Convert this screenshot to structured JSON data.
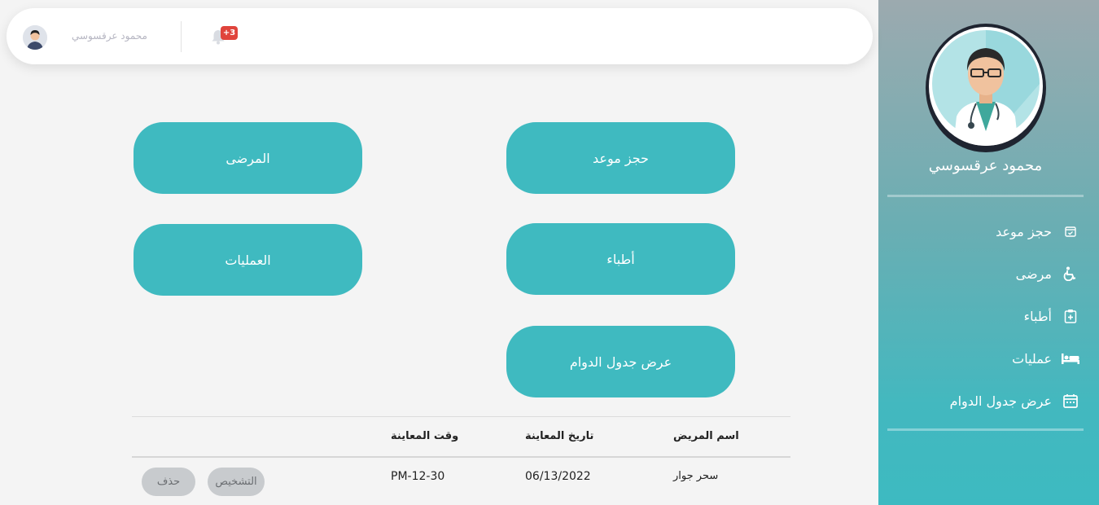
{
  "profile": {
    "name": "محمود عرقسوسي"
  },
  "menu": [
    {
      "label": "حجز موعد",
      "icon": "calendar-check-icon"
    },
    {
      "label": "مرضى",
      "icon": "wheelchair-icon"
    },
    {
      "label": "أطباء",
      "icon": "clipboard-plus-icon"
    },
    {
      "label": "عمليات",
      "icon": "bed-icon"
    },
    {
      "label": "عرض جدول الدوام",
      "icon": "calendar-icon"
    }
  ],
  "topbar": {
    "user_name": "محمود عرقسوسي",
    "notifications": "+3"
  },
  "tiles": {
    "patients": "المرضى",
    "book": "حجز موعد",
    "operations": "العمليات",
    "doctors": "أطباء",
    "schedule": "عرض جدول الدوام"
  },
  "table": {
    "headers": {
      "patient": "اسم المريض",
      "date": "تاريخ المعاينة",
      "time": "وقت المعاينة"
    },
    "rows": [
      {
        "patient": "سحر جوار",
        "date": "06/13/2022",
        "time": "PM-12-30",
        "diagnose": "التشخيص",
        "delete": "حذف"
      }
    ]
  },
  "colors": {
    "accent": "#3fbac0",
    "badge": "#e0443c"
  }
}
